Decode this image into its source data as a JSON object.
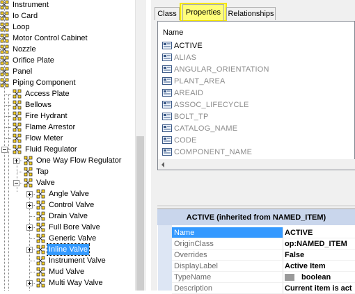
{
  "tree": {
    "items": [
      {
        "label": "Instrument"
      },
      {
        "label": "Io Card"
      },
      {
        "label": "Loop"
      },
      {
        "label": "Motor Control Cabinet"
      },
      {
        "label": "Nozzle"
      },
      {
        "label": "Orifice Plate"
      },
      {
        "label": "Panel"
      },
      {
        "label": "Piping Component"
      },
      {
        "label": "Access Plate"
      },
      {
        "label": "Bellows"
      },
      {
        "label": "Fire Hydrant"
      },
      {
        "label": "Flame Arrestor"
      },
      {
        "label": "Flow Meter"
      },
      {
        "label": "Fluid Regulator"
      },
      {
        "label": "One Way Flow Regulator"
      },
      {
        "label": "Tap"
      },
      {
        "label": "Valve"
      },
      {
        "label": "Angle Valve"
      },
      {
        "label": "Control Valve"
      },
      {
        "label": "Drain Valve"
      },
      {
        "label": "Full Bore Valve"
      },
      {
        "label": "Generic Valve"
      },
      {
        "label": "Inline Valve"
      },
      {
        "label": "Instrument Valve"
      },
      {
        "label": "Mud Valve"
      },
      {
        "label": "Multi Way Valve"
      }
    ]
  },
  "tabs": [
    {
      "label": "Class"
    },
    {
      "label": "Properties"
    },
    {
      "label": "Relationships"
    }
  ],
  "properties_list": {
    "header": "Name",
    "items": [
      "ACTIVE",
      "ALIAS",
      "ANGULAR_ORIENTATION",
      "PLANT_AREA",
      "AREAID",
      "ASSOC_LIFECYCLE",
      "BOLT_TP",
      "CATALOG_NAME",
      "CODE",
      "COMPONENT_NAME"
    ]
  },
  "detail": {
    "title": "ACTIVE (inherited from NAMED_ITEM)",
    "rows": [
      {
        "name": "Name",
        "value": "ACTIVE"
      },
      {
        "name": "OriginClass",
        "value": "op:NAMED_ITEM"
      },
      {
        "name": "Overrides",
        "value": "False"
      },
      {
        "name": "DisplayLabel",
        "value": "Active Item"
      },
      {
        "name": "TypeName",
        "value": "boolean"
      },
      {
        "name": "Description",
        "value": "Current item is act"
      }
    ]
  },
  "colors": {
    "highlight": "#f5e600",
    "selection": "#3399ff",
    "detail_header": "#c9d6ec"
  }
}
